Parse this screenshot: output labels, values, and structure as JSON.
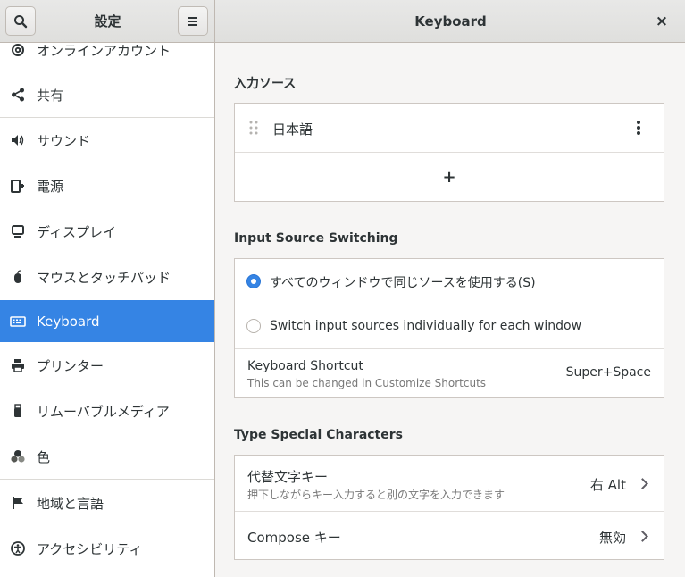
{
  "header": {
    "left_title": "設定",
    "right_title": "Keyboard",
    "close_glyph": "×"
  },
  "sidebar": {
    "items": [
      {
        "label": "オンラインアカウント",
        "icon": "at-icon"
      },
      {
        "label": "共有",
        "icon": "share-icon"
      },
      {
        "label": "サウンド",
        "icon": "speaker-icon"
      },
      {
        "label": "電源",
        "icon": "power-icon"
      },
      {
        "label": "ディスプレイ",
        "icon": "display-icon"
      },
      {
        "label": "マウスとタッチパッド",
        "icon": "mouse-icon"
      },
      {
        "label": "Keyboard",
        "icon": "keyboard-icon",
        "selected": true
      },
      {
        "label": "プリンター",
        "icon": "printer-icon"
      },
      {
        "label": "リムーバブルメディア",
        "icon": "usb-icon"
      },
      {
        "label": "色",
        "icon": "color-icon"
      },
      {
        "label": "地域と言語",
        "icon": "flag-icon"
      },
      {
        "label": "アクセシビリティ",
        "icon": "accessibility-icon"
      }
    ]
  },
  "input_sources": {
    "title": "入力ソース",
    "source_name": "日本語",
    "add_glyph": "+"
  },
  "switching": {
    "title": "Input Source Switching",
    "option_same": "すべてのウィンドウで同じソースを使用する(S)",
    "option_individual": "Switch input sources individually for each window",
    "selected": "option_same",
    "shortcut_label": "Keyboard Shortcut",
    "shortcut_hint": "This can be changed in Customize Shortcuts",
    "shortcut_value": "Super+Space"
  },
  "special_chars": {
    "title": "Type Special Characters",
    "alternate_label": "代替文字キー",
    "alternate_hint": "押下しながらキー入力すると別の文字を入力できます",
    "alternate_value": "右 Alt",
    "compose_label": "Compose キー",
    "compose_value": "無効"
  },
  "colors": {
    "accent": "#3584e4"
  }
}
